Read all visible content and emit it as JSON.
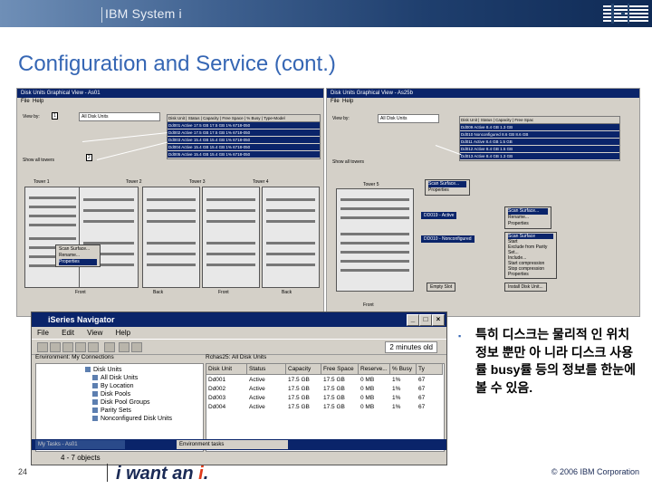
{
  "header": {
    "brand": "IBM System i",
    "logo_text": "IBM"
  },
  "slide": {
    "title": "Configuration and Service (cont.)"
  },
  "left_window": {
    "title": "Disk Units Graphical View - As01",
    "menu": [
      "File",
      "Help"
    ],
    "view_by_label": "View by:",
    "view_by_value": "All Disk Units",
    "marker_1": "1",
    "marker_2": "2",
    "show_all_towers": "Show all towers",
    "grid_headers": [
      "Disk Unit",
      "Status",
      "Capacity",
      "Free Space",
      "% Busy",
      "Type-Model"
    ],
    "grid_rows": [
      [
        "Dd001",
        "Active",
        "17.5 GB",
        "17.5 GB",
        "1%",
        "6718-050"
      ],
      [
        "Dd002",
        "Active",
        "17.5 GB",
        "17.5 GB",
        "1%",
        "6718-050"
      ],
      [
        "Dd003",
        "Active",
        "15.4 GB",
        "15.4 GB",
        "1%",
        "6718-050"
      ],
      [
        "Dd004",
        "Active",
        "15.4 GB",
        "15.4 GB",
        "1%",
        "6718-050"
      ],
      [
        "Dd005",
        "Active",
        "15.4 GB",
        "15.4 GB",
        "1%",
        "6718-050"
      ]
    ],
    "towers": [
      "Tower 1",
      "Tower 2",
      "Tower 3",
      "Tower 4"
    ],
    "labels": [
      "Front",
      "Back",
      "Front",
      "Back"
    ],
    "context_menu": [
      "Scan Surface...",
      "Rename...",
      "Properties"
    ]
  },
  "right_window": {
    "title": "Disk Units Graphical View - As25b",
    "menu": [
      "File",
      "Help"
    ],
    "view_by_label": "View by:",
    "view_by_value": "All Disk Units",
    "show_all_towers": "Show all towers",
    "grid_headers": [
      "Disk Unit",
      "Status",
      "Capacity",
      "Free Spac"
    ],
    "grid_rows": [
      [
        "Dd009",
        "Active",
        "8.4 GB",
        "1.3 GB"
      ],
      [
        "Dd010",
        "Nonconfigured",
        "8.6 GB",
        "8.6 GB"
      ],
      [
        "Dd011",
        "Active",
        "8.4 GB",
        "1.5 GB"
      ],
      [
        "Dd012",
        "Active",
        "8.4 GB",
        "1.5 GB"
      ],
      [
        "Dd013",
        "Active",
        "8.4 GB",
        "1.3 GB"
      ]
    ],
    "tower": "Tower 5",
    "front_label": "Front",
    "menu_a": [
      "Scan Surface...",
      "Properties"
    ],
    "callout_1": "DD019 - Active",
    "callout_2": "DD010 - Nonconfigured",
    "menu_b": [
      "Scan Surface...",
      "Rename...",
      "Properties"
    ],
    "menu_c": [
      "Scan Surface",
      "Start",
      "Exclude from Parity Set...",
      "Include...",
      "Start compression",
      "Stop compression",
      "Properties"
    ],
    "empty_slot": "Empty Slot",
    "install_button": "Install Disk Unit..."
  },
  "navigator": {
    "title": "iSeries Navigator",
    "menu": [
      "File",
      "Edit",
      "View",
      "Help"
    ],
    "env_text": "2 minutes old",
    "env_label": "Environment: My Connections",
    "list_label": "Rchas25: All Disk Units",
    "tree": [
      "Disk Units",
      "All Disk Units",
      "By Location",
      "Disk Pools",
      "Disk Pool Groups",
      "Parity Sets",
      "Nonconfigured Disk Units"
    ],
    "columns": [
      "Disk Unit",
      "Status",
      "Capacity",
      "Free Space",
      "Reserve...",
      "% Busy",
      "Ty"
    ],
    "rows": [
      [
        "Dd001",
        "Active",
        "17.5 GB",
        "17.5 GB",
        "0 MB",
        "1%",
        "67"
      ],
      [
        "Dd002",
        "Active",
        "17.5 GB",
        "17.5 GB",
        "0 MB",
        "1%",
        "67"
      ],
      [
        "Dd003",
        "Active",
        "17.5 GB",
        "17.5 GB",
        "0 MB",
        "1%",
        "67"
      ],
      [
        "Dd004",
        "Active",
        "17.5 GB",
        "17.5 GB",
        "0 MB",
        "1%",
        "67"
      ]
    ],
    "taskbar_item_1": "My Tasks - As01",
    "taskbar_item_2": "Environment tasks",
    "status": "4 - 7 objects"
  },
  "bullet": {
    "marker": "▪",
    "text": "특히 디스크는 물리적 인 위치 정보 뿐만 아 니라 디스크 사용률 busy률 등의 정보를 한눈에 볼 수 있음."
  },
  "footer": {
    "page_number": "24",
    "tagline_pre": "i want an ",
    "tagline_i": "i",
    "tagline_post": ".",
    "copyright": "© 2006 IBM Corporation"
  },
  "colors": {
    "title_blue": "#3566b4",
    "window_blue": "#0a246a",
    "accent_red": "#e03a1a"
  }
}
